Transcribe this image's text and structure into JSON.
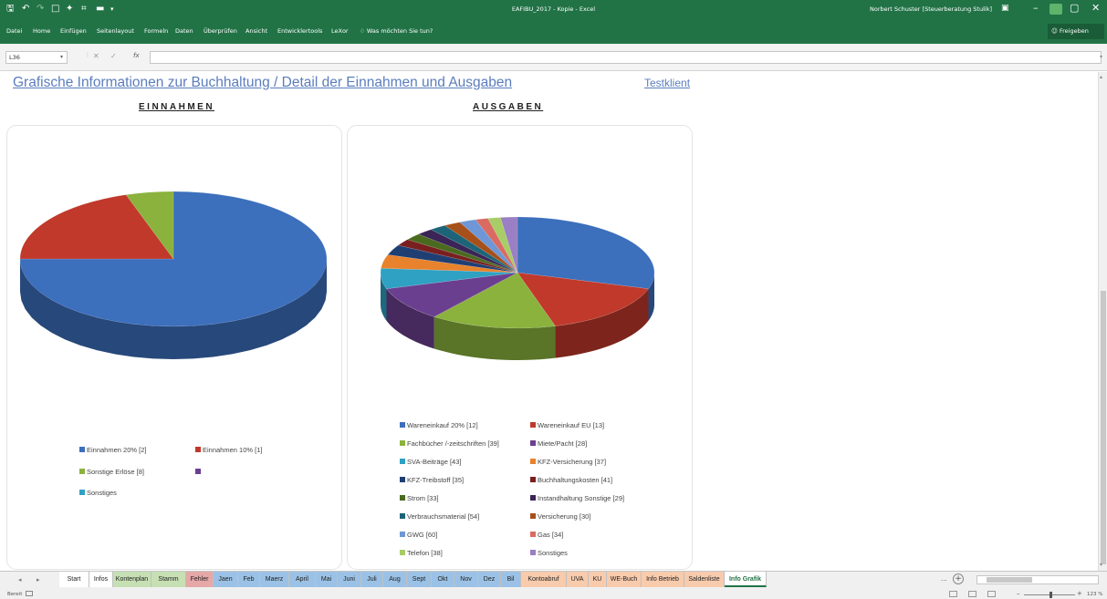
{
  "window": {
    "title": "EAFIBU_2017 - Kopie  -  Excel",
    "user": "Norbert Schuster [Steuerberatung Stulik]"
  },
  "ribbon": {
    "tabs": [
      "Datei",
      "Home",
      "Einfügen",
      "Seitenlayout",
      "Formeln",
      "Daten",
      "Überprüfen",
      "Ansicht",
      "Entwicklertools",
      "LeXor"
    ],
    "tellme": "Was möchten Sie tun?",
    "share": "Freigeben"
  },
  "formula_bar": {
    "cell_ref": "L36",
    "fx": "fx",
    "value": ""
  },
  "sheet": {
    "title": "Grafische Informationen zur Buchhaltung / Detail der Einnahmen und Ausgaben",
    "client": "Testklient",
    "einnahmen_heading": "EINNAHMEN",
    "ausgaben_heading": "AUSGABEN"
  },
  "chart_data": [
    {
      "type": "pie",
      "title": "EINNAHMEN",
      "categories": [
        "Einnahmen 20% [2]",
        "Einnahmen 10% [1]",
        "Sonstige Erlöse [8]",
        "",
        "Sonstiges"
      ],
      "values": [
        75,
        20,
        5,
        0,
        0
      ],
      "colors": [
        "#3c6fbc",
        "#c0392b",
        "#8ab23d",
        "#6b3f8f",
        "#2fa1c3"
      ],
      "legend_position": "bottom"
    },
    {
      "type": "pie",
      "title": "AUSGABEN",
      "categories": [
        "Wareneinkauf 20% [12]",
        "Wareneinkauf EU [13]",
        "Fachbücher /-zeitschriften [39]",
        "Miete/Pacht [28]",
        "SVA-Beiträge [43]",
        "KFZ-Versicherung [37]",
        "KFZ-Treibstoff [35]",
        "Buchhaltungskosten [41]",
        "Strom [33]",
        "Instandhaltung Sonstige [29]",
        "Verbrauchsmaterial [54]",
        "Versicherung [30]",
        "GWG [60]",
        "Gas [34]",
        "Telefon [38]",
        "Sonstiges"
      ],
      "values": [
        30,
        16,
        15,
        10,
        6,
        4,
        3,
        2,
        2,
        2,
        2,
        2,
        2,
        1.5,
        1.5,
        2
      ],
      "colors": [
        "#3c6fbc",
        "#c0392b",
        "#8ab23d",
        "#6b3f8f",
        "#2fa1c3",
        "#e8822c",
        "#1f3f73",
        "#7a1f1f",
        "#4a6a1f",
        "#3b2456",
        "#1d6478",
        "#a8501a",
        "#6f97d6",
        "#d96b63",
        "#a8cc66",
        "#9a7fc4"
      ],
      "legend_position": "bottom"
    }
  ],
  "sheet_tabs": [
    {
      "label": "Start",
      "color": "#ffffff"
    },
    {
      "label": "Infos",
      "color": "#ffffff"
    },
    {
      "label": "Kontenplan",
      "color": "#c6e0b4"
    },
    {
      "label": "Stamm",
      "color": "#c6e0b4"
    },
    {
      "label": "Fehler",
      "color": "#e6a7a7"
    },
    {
      "label": "Jaen",
      "color": "#9bc2e6"
    },
    {
      "label": "Feb",
      "color": "#9bc2e6"
    },
    {
      "label": "Maerz",
      "color": "#9bc2e6"
    },
    {
      "label": "April",
      "color": "#9bc2e6"
    },
    {
      "label": "Mai",
      "color": "#9bc2e6"
    },
    {
      "label": "Juni",
      "color": "#9bc2e6"
    },
    {
      "label": "Juli",
      "color": "#9bc2e6"
    },
    {
      "label": "Aug",
      "color": "#9bc2e6"
    },
    {
      "label": "Sept",
      "color": "#9bc2e6"
    },
    {
      "label": "Okt",
      "color": "#9bc2e6"
    },
    {
      "label": "Nov",
      "color": "#9bc2e6"
    },
    {
      "label": "Dez",
      "color": "#9bc2e6"
    },
    {
      "label": "Bil",
      "color": "#9bc2e6"
    },
    {
      "label": "Kontoabruf",
      "color": "#f8cbad"
    },
    {
      "label": "UVA",
      "color": "#f8cbad"
    },
    {
      "label": "KU",
      "color": "#f8cbad"
    },
    {
      "label": "WE-Buch",
      "color": "#f8cbad"
    },
    {
      "label": "Info Betrieb",
      "color": "#f8cbad"
    },
    {
      "label": "Saldenliste",
      "color": "#f8cbad"
    },
    {
      "label": "Info Grafik",
      "color": "#ffffff",
      "active": true
    }
  ],
  "sheet_tabs_more": "...",
  "status": {
    "ready": "Bereit",
    "zoom": "123 %"
  },
  "colors": {
    "excel_green": "#217346",
    "title_blue": "#5b7dbd"
  }
}
